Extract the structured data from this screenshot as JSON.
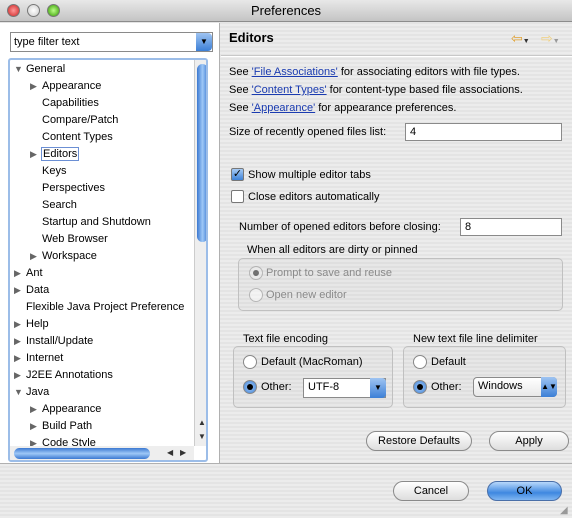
{
  "window": {
    "title": "Preferences"
  },
  "filter": {
    "placeholder": "type filter text"
  },
  "tree": [
    {
      "label": "General",
      "level": 0,
      "state": "expanded"
    },
    {
      "label": "Appearance",
      "level": 1,
      "state": "collapsed"
    },
    {
      "label": "Capabilities",
      "level": 1,
      "state": "leaf"
    },
    {
      "label": "Compare/Patch",
      "level": 1,
      "state": "leaf"
    },
    {
      "label": "Content Types",
      "level": 1,
      "state": "leaf"
    },
    {
      "label": "Editors",
      "level": 1,
      "state": "collapsed",
      "selected": true
    },
    {
      "label": "Keys",
      "level": 1,
      "state": "leaf"
    },
    {
      "label": "Perspectives",
      "level": 1,
      "state": "leaf"
    },
    {
      "label": "Search",
      "level": 1,
      "state": "leaf"
    },
    {
      "label": "Startup and Shutdown",
      "level": 1,
      "state": "leaf"
    },
    {
      "label": "Web Browser",
      "level": 1,
      "state": "leaf"
    },
    {
      "label": "Workspace",
      "level": 1,
      "state": "collapsed"
    },
    {
      "label": "Ant",
      "level": 0,
      "state": "collapsed"
    },
    {
      "label": "Data",
      "level": 0,
      "state": "collapsed"
    },
    {
      "label": "Flexible Java Project Preference",
      "level": 0,
      "state": "leaf"
    },
    {
      "label": "Help",
      "level": 0,
      "state": "collapsed"
    },
    {
      "label": "Install/Update",
      "level": 0,
      "state": "collapsed"
    },
    {
      "label": "Internet",
      "level": 0,
      "state": "collapsed"
    },
    {
      "label": "J2EE Annotations",
      "level": 0,
      "state": "collapsed"
    },
    {
      "label": "Java",
      "level": 0,
      "state": "expanded"
    },
    {
      "label": "Appearance",
      "level": 1,
      "state": "collapsed"
    },
    {
      "label": "Build Path",
      "level": 1,
      "state": "collapsed"
    },
    {
      "label": "Code Style",
      "level": 1,
      "state": "collapsed"
    }
  ],
  "page": {
    "title": "Editors",
    "links": [
      {
        "pre": "See ",
        "link": "'File Associations'",
        "post": " for associating editors with file types."
      },
      {
        "pre": "See ",
        "link": "'Content Types'",
        "post": " for content-type based file associations."
      },
      {
        "pre": "See ",
        "link": "'Appearance'",
        "post": " for appearance preferences."
      }
    ],
    "recent_label": "Size of recently opened files list:",
    "recent_value": "4",
    "show_tabs_label": "Show multiple editor tabs",
    "show_tabs": true,
    "close_auto_label": "Close editors automatically",
    "close_auto": false,
    "num_editors_label": "Number of opened editors before closing:",
    "num_editors_value": "8",
    "dirty_group": {
      "label": "When all editors are dirty or pinned",
      "opt1": "Prompt to save and reuse",
      "opt2": "Open new editor",
      "selected": "opt1",
      "disabled": true
    },
    "encoding": {
      "label": "Text file encoding",
      "default": "Default (MacRoman)",
      "other": "Other:",
      "value": "UTF-8",
      "selected": "other"
    },
    "delimiter": {
      "label": "New text file line delimiter",
      "default": "Default",
      "other": "Other:",
      "value": "Windows",
      "selected": "other"
    },
    "restore": "Restore Defaults",
    "apply": "Apply"
  },
  "footer": {
    "cancel": "Cancel",
    "ok": "OK"
  }
}
